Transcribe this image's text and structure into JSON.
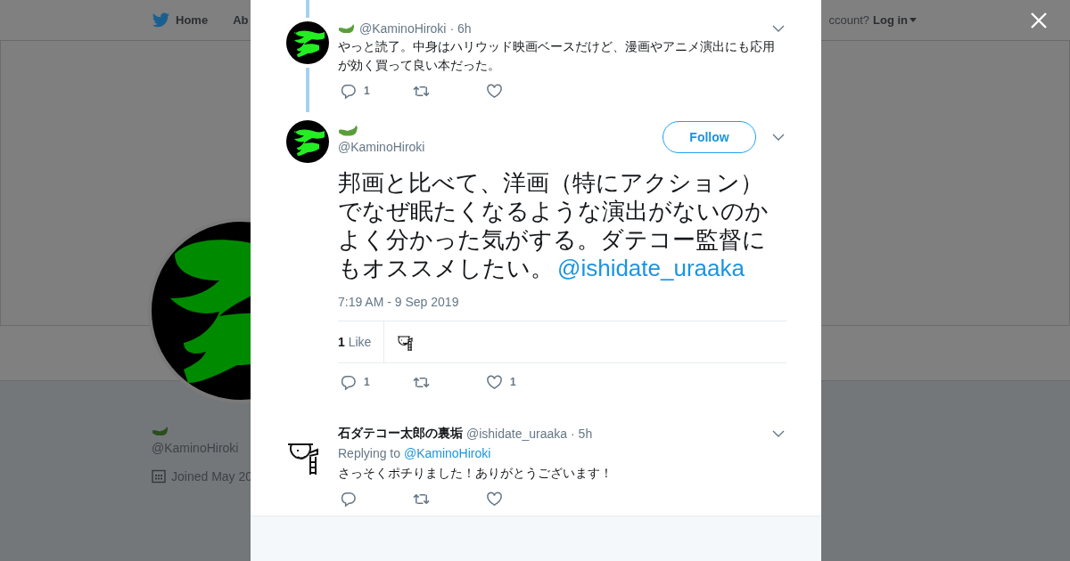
{
  "background_page": {
    "nav": [
      {
        "label": "Home"
      },
      {
        "label": "Ab"
      }
    ],
    "login_prompt": "ccount?",
    "login": "Log in",
    "profile": {
      "handle": "@KaminoHiroki",
      "joined": "Joined May 20"
    }
  },
  "modal": {
    "parent_tweet": {
      "handle": "@KaminoHiroki",
      "time": "· 6h",
      "text": "やっと読了。中身はハリウッド映画ベースだけど、漫画やアニメ演出にも応用が効く買って良い本だった。",
      "actions": [
        {
          "kind": "reply",
          "count": "1"
        },
        {
          "kind": "retweet"
        },
        {
          "kind": "like"
        }
      ]
    },
    "main_tweet": {
      "handle": "@KaminoHiroki",
      "follow": "Follow",
      "text": "邦画と比べて、洋画（特にアクション）でなぜ眠たくなるような演出がないのかよく分かった気がする。ダテコー監督にもオススメしたい。",
      "mention": "@ishidate_uraaka",
      "timestamp": "7:19 AM - 9 Sep 2019",
      "likes": "**1** Like",
      "actions": [
        {
          "kind": "reply",
          "count": "1"
        },
        {
          "kind": "retweet"
        },
        {
          "kind": "like",
          "count": "1"
        }
      ]
    },
    "reply": {
      "name": "石ダテコー太郎の裏垢",
      "handle": "@ishidate_uraaka",
      "time": "· 5h",
      "replying_prefix": "Replying to",
      "replying_to": "@KaminoHiroki",
      "text": "さっそくポチりました！ありがとうございます！",
      "actions": [
        {
          "kind": "reply"
        },
        {
          "kind": "retweet"
        },
        {
          "kind": "like"
        }
      ]
    }
  }
}
